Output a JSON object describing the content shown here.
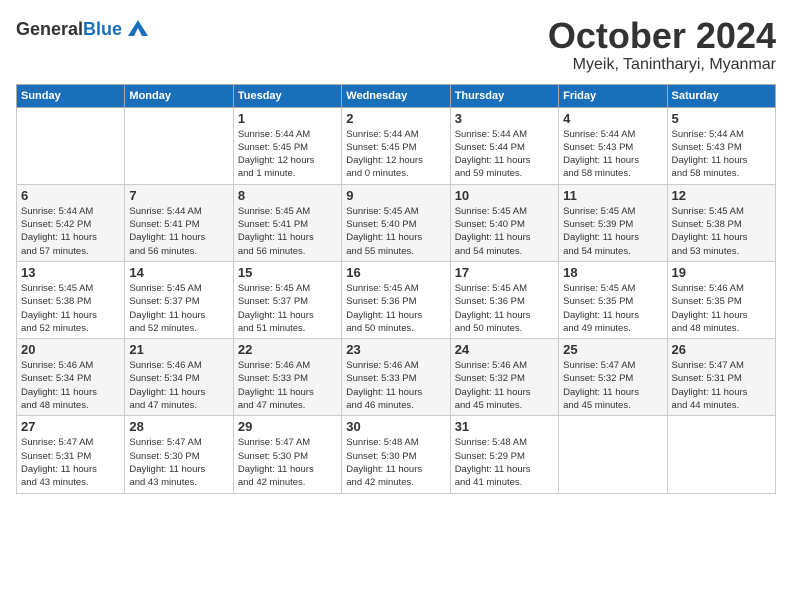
{
  "logo": {
    "general": "General",
    "blue": "Blue"
  },
  "header": {
    "month": "October 2024",
    "location": "Myeik, Tanintharyi, Myanmar"
  },
  "days_of_week": [
    "Sunday",
    "Monday",
    "Tuesday",
    "Wednesday",
    "Thursday",
    "Friday",
    "Saturday"
  ],
  "weeks": [
    [
      {
        "day": "",
        "info": ""
      },
      {
        "day": "",
        "info": ""
      },
      {
        "day": "1",
        "info": "Sunrise: 5:44 AM\nSunset: 5:45 PM\nDaylight: 12 hours\nand 1 minute."
      },
      {
        "day": "2",
        "info": "Sunrise: 5:44 AM\nSunset: 5:45 PM\nDaylight: 12 hours\nand 0 minutes."
      },
      {
        "day": "3",
        "info": "Sunrise: 5:44 AM\nSunset: 5:44 PM\nDaylight: 11 hours\nand 59 minutes."
      },
      {
        "day": "4",
        "info": "Sunrise: 5:44 AM\nSunset: 5:43 PM\nDaylight: 11 hours\nand 58 minutes."
      },
      {
        "day": "5",
        "info": "Sunrise: 5:44 AM\nSunset: 5:43 PM\nDaylight: 11 hours\nand 58 minutes."
      }
    ],
    [
      {
        "day": "6",
        "info": "Sunrise: 5:44 AM\nSunset: 5:42 PM\nDaylight: 11 hours\nand 57 minutes."
      },
      {
        "day": "7",
        "info": "Sunrise: 5:44 AM\nSunset: 5:41 PM\nDaylight: 11 hours\nand 56 minutes."
      },
      {
        "day": "8",
        "info": "Sunrise: 5:45 AM\nSunset: 5:41 PM\nDaylight: 11 hours\nand 56 minutes."
      },
      {
        "day": "9",
        "info": "Sunrise: 5:45 AM\nSunset: 5:40 PM\nDaylight: 11 hours\nand 55 minutes."
      },
      {
        "day": "10",
        "info": "Sunrise: 5:45 AM\nSunset: 5:40 PM\nDaylight: 11 hours\nand 54 minutes."
      },
      {
        "day": "11",
        "info": "Sunrise: 5:45 AM\nSunset: 5:39 PM\nDaylight: 11 hours\nand 54 minutes."
      },
      {
        "day": "12",
        "info": "Sunrise: 5:45 AM\nSunset: 5:38 PM\nDaylight: 11 hours\nand 53 minutes."
      }
    ],
    [
      {
        "day": "13",
        "info": "Sunrise: 5:45 AM\nSunset: 5:38 PM\nDaylight: 11 hours\nand 52 minutes."
      },
      {
        "day": "14",
        "info": "Sunrise: 5:45 AM\nSunset: 5:37 PM\nDaylight: 11 hours\nand 52 minutes."
      },
      {
        "day": "15",
        "info": "Sunrise: 5:45 AM\nSunset: 5:37 PM\nDaylight: 11 hours\nand 51 minutes."
      },
      {
        "day": "16",
        "info": "Sunrise: 5:45 AM\nSunset: 5:36 PM\nDaylight: 11 hours\nand 50 minutes."
      },
      {
        "day": "17",
        "info": "Sunrise: 5:45 AM\nSunset: 5:36 PM\nDaylight: 11 hours\nand 50 minutes."
      },
      {
        "day": "18",
        "info": "Sunrise: 5:45 AM\nSunset: 5:35 PM\nDaylight: 11 hours\nand 49 minutes."
      },
      {
        "day": "19",
        "info": "Sunrise: 5:46 AM\nSunset: 5:35 PM\nDaylight: 11 hours\nand 48 minutes."
      }
    ],
    [
      {
        "day": "20",
        "info": "Sunrise: 5:46 AM\nSunset: 5:34 PM\nDaylight: 11 hours\nand 48 minutes."
      },
      {
        "day": "21",
        "info": "Sunrise: 5:46 AM\nSunset: 5:34 PM\nDaylight: 11 hours\nand 47 minutes."
      },
      {
        "day": "22",
        "info": "Sunrise: 5:46 AM\nSunset: 5:33 PM\nDaylight: 11 hours\nand 47 minutes."
      },
      {
        "day": "23",
        "info": "Sunrise: 5:46 AM\nSunset: 5:33 PM\nDaylight: 11 hours\nand 46 minutes."
      },
      {
        "day": "24",
        "info": "Sunrise: 5:46 AM\nSunset: 5:32 PM\nDaylight: 11 hours\nand 45 minutes."
      },
      {
        "day": "25",
        "info": "Sunrise: 5:47 AM\nSunset: 5:32 PM\nDaylight: 11 hours\nand 45 minutes."
      },
      {
        "day": "26",
        "info": "Sunrise: 5:47 AM\nSunset: 5:31 PM\nDaylight: 11 hours\nand 44 minutes."
      }
    ],
    [
      {
        "day": "27",
        "info": "Sunrise: 5:47 AM\nSunset: 5:31 PM\nDaylight: 11 hours\nand 43 minutes."
      },
      {
        "day": "28",
        "info": "Sunrise: 5:47 AM\nSunset: 5:30 PM\nDaylight: 11 hours\nand 43 minutes."
      },
      {
        "day": "29",
        "info": "Sunrise: 5:47 AM\nSunset: 5:30 PM\nDaylight: 11 hours\nand 42 minutes."
      },
      {
        "day": "30",
        "info": "Sunrise: 5:48 AM\nSunset: 5:30 PM\nDaylight: 11 hours\nand 42 minutes."
      },
      {
        "day": "31",
        "info": "Sunrise: 5:48 AM\nSunset: 5:29 PM\nDaylight: 11 hours\nand 41 minutes."
      },
      {
        "day": "",
        "info": ""
      },
      {
        "day": "",
        "info": ""
      }
    ]
  ]
}
